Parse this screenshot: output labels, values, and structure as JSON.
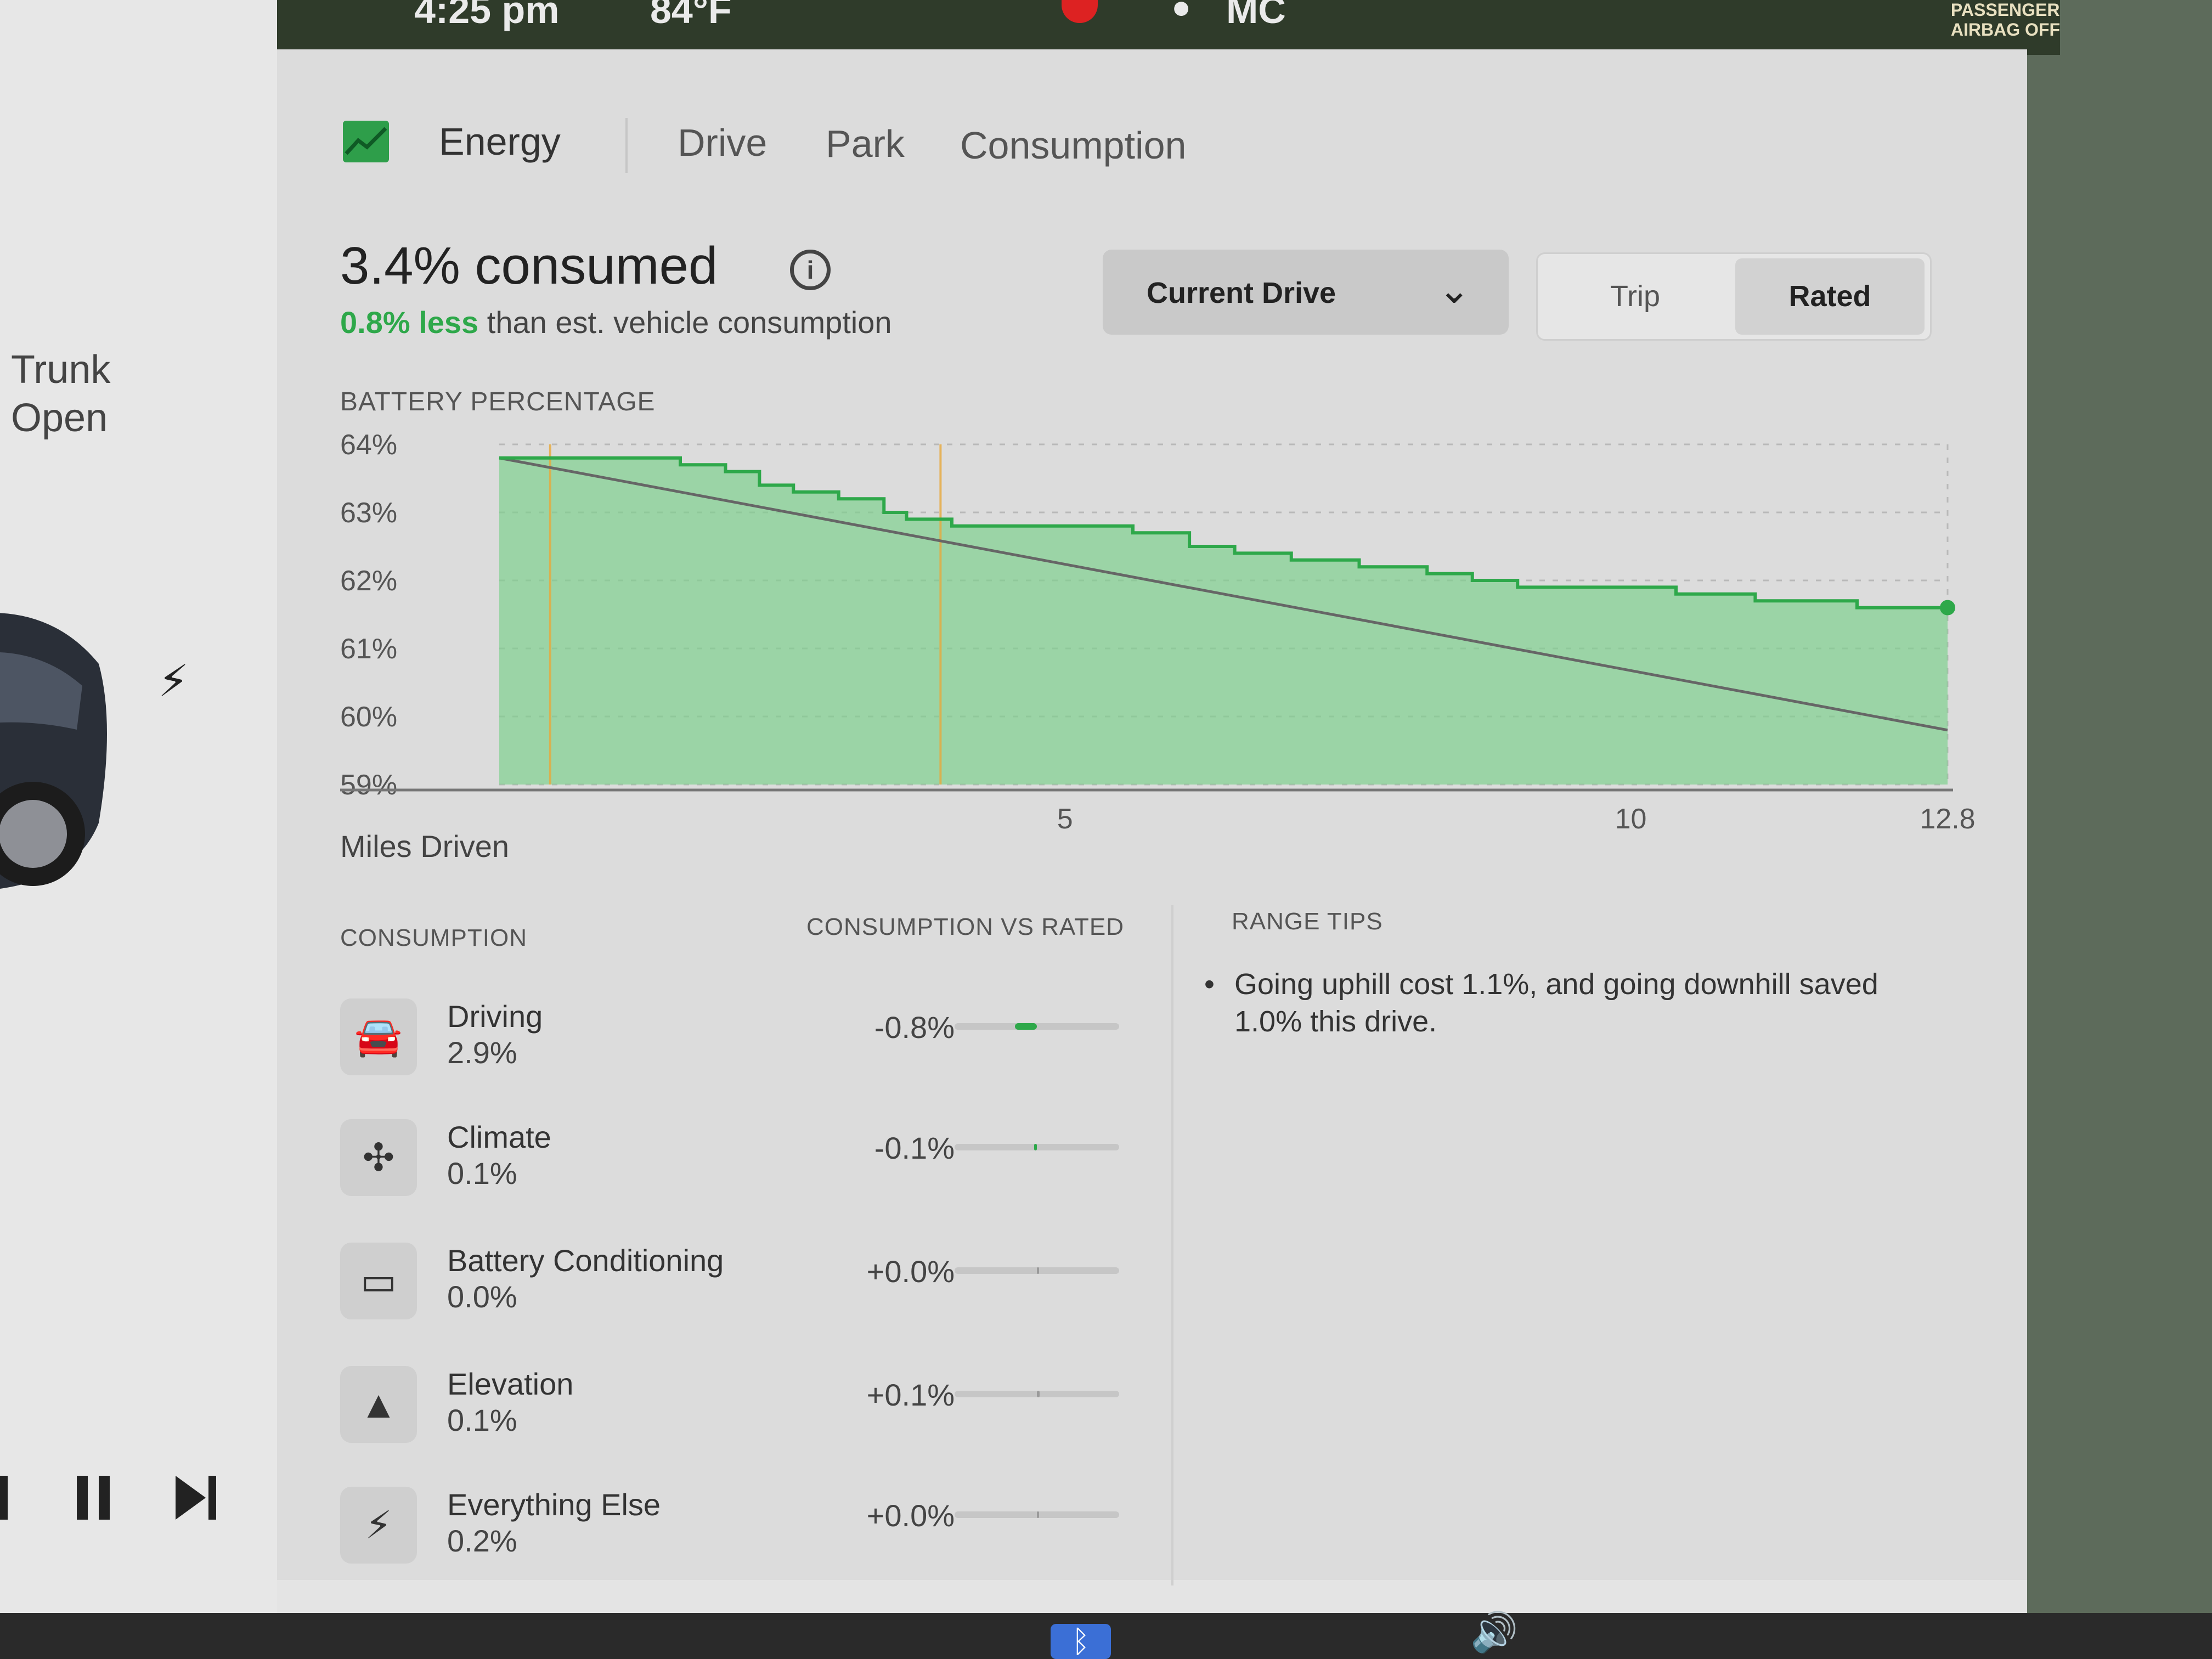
{
  "statusbar": {
    "time": "4:25 pm",
    "temp": "84°F",
    "profile": "MC",
    "airbag_line1": "PASSENGER",
    "airbag_line2": "AIRBAG OFF"
  },
  "left": {
    "trunk_line1": "Trunk",
    "trunk_line2": "Open"
  },
  "tabs": {
    "energy": "Energy",
    "drive": "Drive",
    "park": "Park",
    "consumption": "Consumption"
  },
  "summary": {
    "headline": "3.4% consumed",
    "sub_green": "0.8% less",
    "sub_rest": " than est. vehicle consumption"
  },
  "controls": {
    "select_value": "Current Drive",
    "toggle_trip": "Trip",
    "toggle_rated": "Rated"
  },
  "chart_data": {
    "type": "line",
    "title": "BATTERY PERCENTAGE",
    "xlabel": "Miles Driven",
    "ylabel": "",
    "xlim": [
      0,
      12.8
    ],
    "ylim": [
      59,
      64
    ],
    "x_ticks": [
      5,
      10,
      12.8
    ],
    "y_ticks": [
      "64%",
      "63%",
      "62%",
      "61%",
      "60%",
      "59%"
    ],
    "series": [
      {
        "values": [
          [
            0,
            63.8
          ],
          [
            1.5,
            63.8
          ],
          [
            1.6,
            63.7
          ],
          [
            2.0,
            63.6
          ],
          [
            2.3,
            63.4
          ],
          [
            2.6,
            63.3
          ],
          [
            3.0,
            63.2
          ],
          [
            3.4,
            63.0
          ],
          [
            3.6,
            62.9
          ],
          [
            4.0,
            62.8
          ],
          [
            5.0,
            62.8
          ],
          [
            5.6,
            62.7
          ],
          [
            6.1,
            62.5
          ],
          [
            6.5,
            62.4
          ],
          [
            7.0,
            62.3
          ],
          [
            7.6,
            62.2
          ],
          [
            8.2,
            62.1
          ],
          [
            8.6,
            62.0
          ],
          [
            9.0,
            61.9
          ],
          [
            10.0,
            61.9
          ],
          [
            10.4,
            61.8
          ],
          [
            11.1,
            61.7
          ],
          [
            12.0,
            61.6
          ],
          [
            12.8,
            61.6
          ]
        ]
      },
      {
        "values": [
          [
            0,
            63.8
          ],
          [
            12.8,
            59.8
          ]
        ]
      }
    ],
    "markers_x": [
      0.45,
      3.9
    ],
    "grid": true
  },
  "sections": {
    "consumption": "CONSUMPTION",
    "vs_rated": "CONSUMPTION VS RATED",
    "range_tips": "RANGE TIPS"
  },
  "rows": [
    {
      "name": "Driving",
      "value": "2.9%",
      "delta": "-0.8%",
      "bar": -0.8
    },
    {
      "name": "Climate",
      "value": "0.1%",
      "delta": "-0.1%",
      "bar": -0.1
    },
    {
      "name": "Battery Conditioning",
      "value": "0.0%",
      "delta": "+0.0%",
      "bar": 0.0
    },
    {
      "name": "Elevation",
      "value": "0.1%",
      "delta": "+0.1%",
      "bar": 0.1
    },
    {
      "name": "Everything Else",
      "value": "0.2%",
      "delta": "+0.0%",
      "bar": 0.0
    }
  ],
  "tip": "Going uphill cost 1.1%, and going downhill saved 1.0% this drive.",
  "colors": {
    "accent_green": "#2ea84a",
    "fill_green": "#7fd08f",
    "card": "#dcdcdc"
  }
}
